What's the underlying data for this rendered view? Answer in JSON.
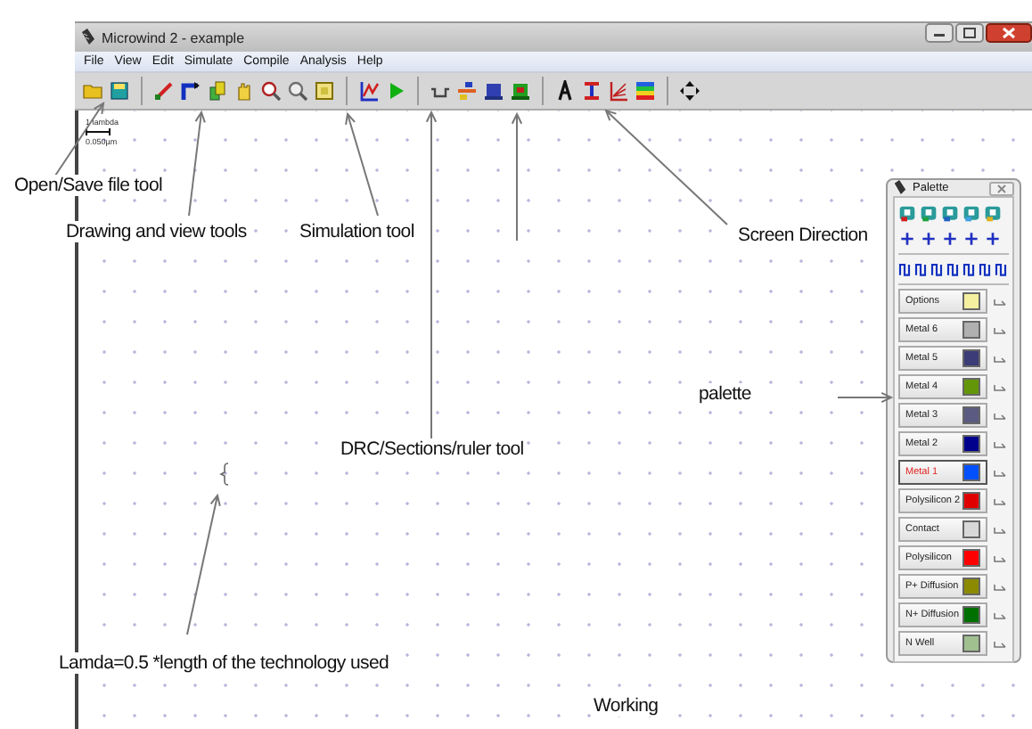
{
  "window": {
    "title": "Microwind 2 - example"
  },
  "menu": [
    "File",
    "View",
    "Edit",
    "Simulate",
    "Compile",
    "Analysis",
    "Help"
  ],
  "scale": {
    "label": "1 lambda",
    "length": "0.050µm"
  },
  "palette": {
    "title": "Palette",
    "layers": [
      {
        "label": "Options",
        "color": "#f4f0a0",
        "selected": false
      },
      {
        "label": "Metal 6",
        "color": "#b0b0b0",
        "selected": false
      },
      {
        "label": "Metal 5",
        "color": "#3c3c78",
        "selected": false
      },
      {
        "label": "Metal 4",
        "color": "#64960a",
        "selected": false
      },
      {
        "label": "Metal 3",
        "color": "#5a5a82",
        "selected": false
      },
      {
        "label": "Metal 2",
        "color": "#00008c",
        "selected": false
      },
      {
        "label": "Metal 1",
        "color": "#0050ff",
        "selected": true
      },
      {
        "label": "Polysilicon 2",
        "color": "#e00000",
        "selected": false
      },
      {
        "label": "Contact",
        "color": "#d8d8d8",
        "selected": false
      },
      {
        "label": "Polysilicon",
        "color": "#ff0000",
        "selected": false
      },
      {
        "label": "P+ Diffusion",
        "color": "#8c8a00",
        "selected": false
      },
      {
        "label": "N+ Diffusion",
        "color": "#007000",
        "selected": false
      },
      {
        "label": "N Well",
        "color": "#a0c090",
        "selected": false
      }
    ]
  },
  "annotations": [
    "Open/Save file tool",
    "Drawing and view tools",
    "Simulation tool",
    "Screen Direction",
    "palette",
    "DRC/Sections/ruler tool",
    "Lamda=0.5 *length of the technology used",
    "Working"
  ]
}
